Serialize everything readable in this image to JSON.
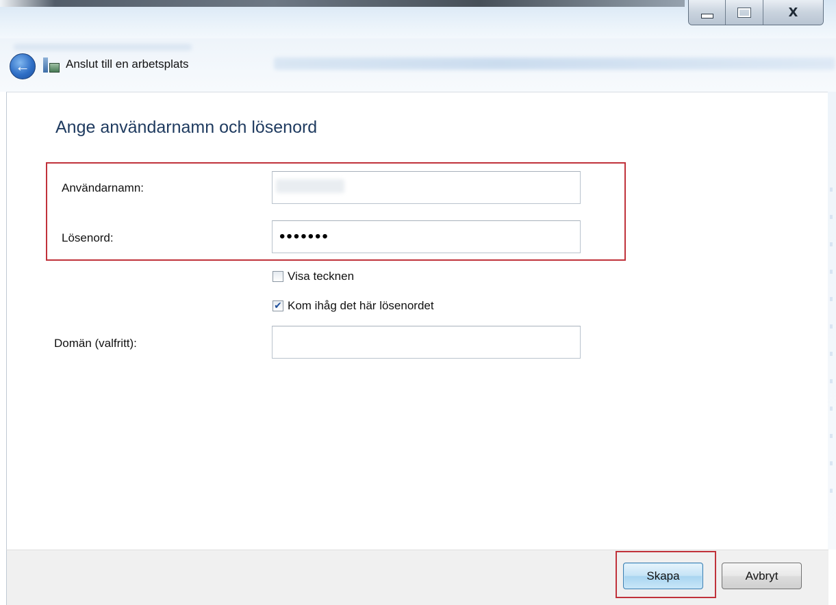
{
  "window": {
    "minimize_glyph": "minimize-icon",
    "maximize_glyph": "maximize-icon",
    "close_label": "X"
  },
  "nav": {
    "back_icon": "back-arrow-icon",
    "title": "Anslut till en arbetsplats"
  },
  "form": {
    "heading": "Ange användarnamn och lösenord",
    "username_label": "Användarnamn:",
    "username_value": "",
    "password_label": "Lösenord:",
    "password_value": "•••••••",
    "show_chars_label": "Visa tecknen",
    "show_chars_checked": false,
    "remember_label": "Kom ihåg det här lösenordet",
    "remember_checked": true,
    "domain_label": "Domän (valfritt):",
    "domain_value": ""
  },
  "footer": {
    "create_label": "Skapa",
    "cancel_label": "Avbryt"
  },
  "colors": {
    "heading": "#1e3a5f",
    "highlight": "#c0313a",
    "primary_button_border": "#3c7fb1"
  }
}
